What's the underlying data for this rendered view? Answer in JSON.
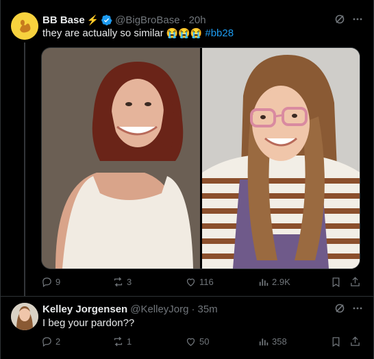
{
  "tweet1": {
    "name": "BB Base",
    "badge": "⚡",
    "handle": "@BigBroBase",
    "separator": "·",
    "time": "20h",
    "text": "they are actually so similar",
    "emojis": "😭😭😭",
    "hashtag": "#bb28",
    "stats": {
      "replies": "9",
      "reposts": "3",
      "likes": "116",
      "views": "2.9K"
    },
    "icons": [
      "grok-icon",
      "more-icon",
      "reply-icon",
      "repost-icon",
      "like-icon",
      "views-icon",
      "bookmark-icon",
      "share-icon"
    ]
  },
  "tweet2": {
    "name": "Kelley Jorgensen",
    "handle": "@KelleyJorg",
    "separator": "·",
    "time": "35m",
    "text": "I beg your pardon??",
    "stats": {
      "replies": "2",
      "reposts": "1",
      "likes": "50",
      "views": "358"
    }
  },
  "colors": {
    "background": "#000000",
    "text": "#e7e9ea",
    "muted": "#71767b",
    "accent": "#1d9bf0",
    "verified": "#1d9bf0",
    "bolt": "#f9c80e"
  }
}
